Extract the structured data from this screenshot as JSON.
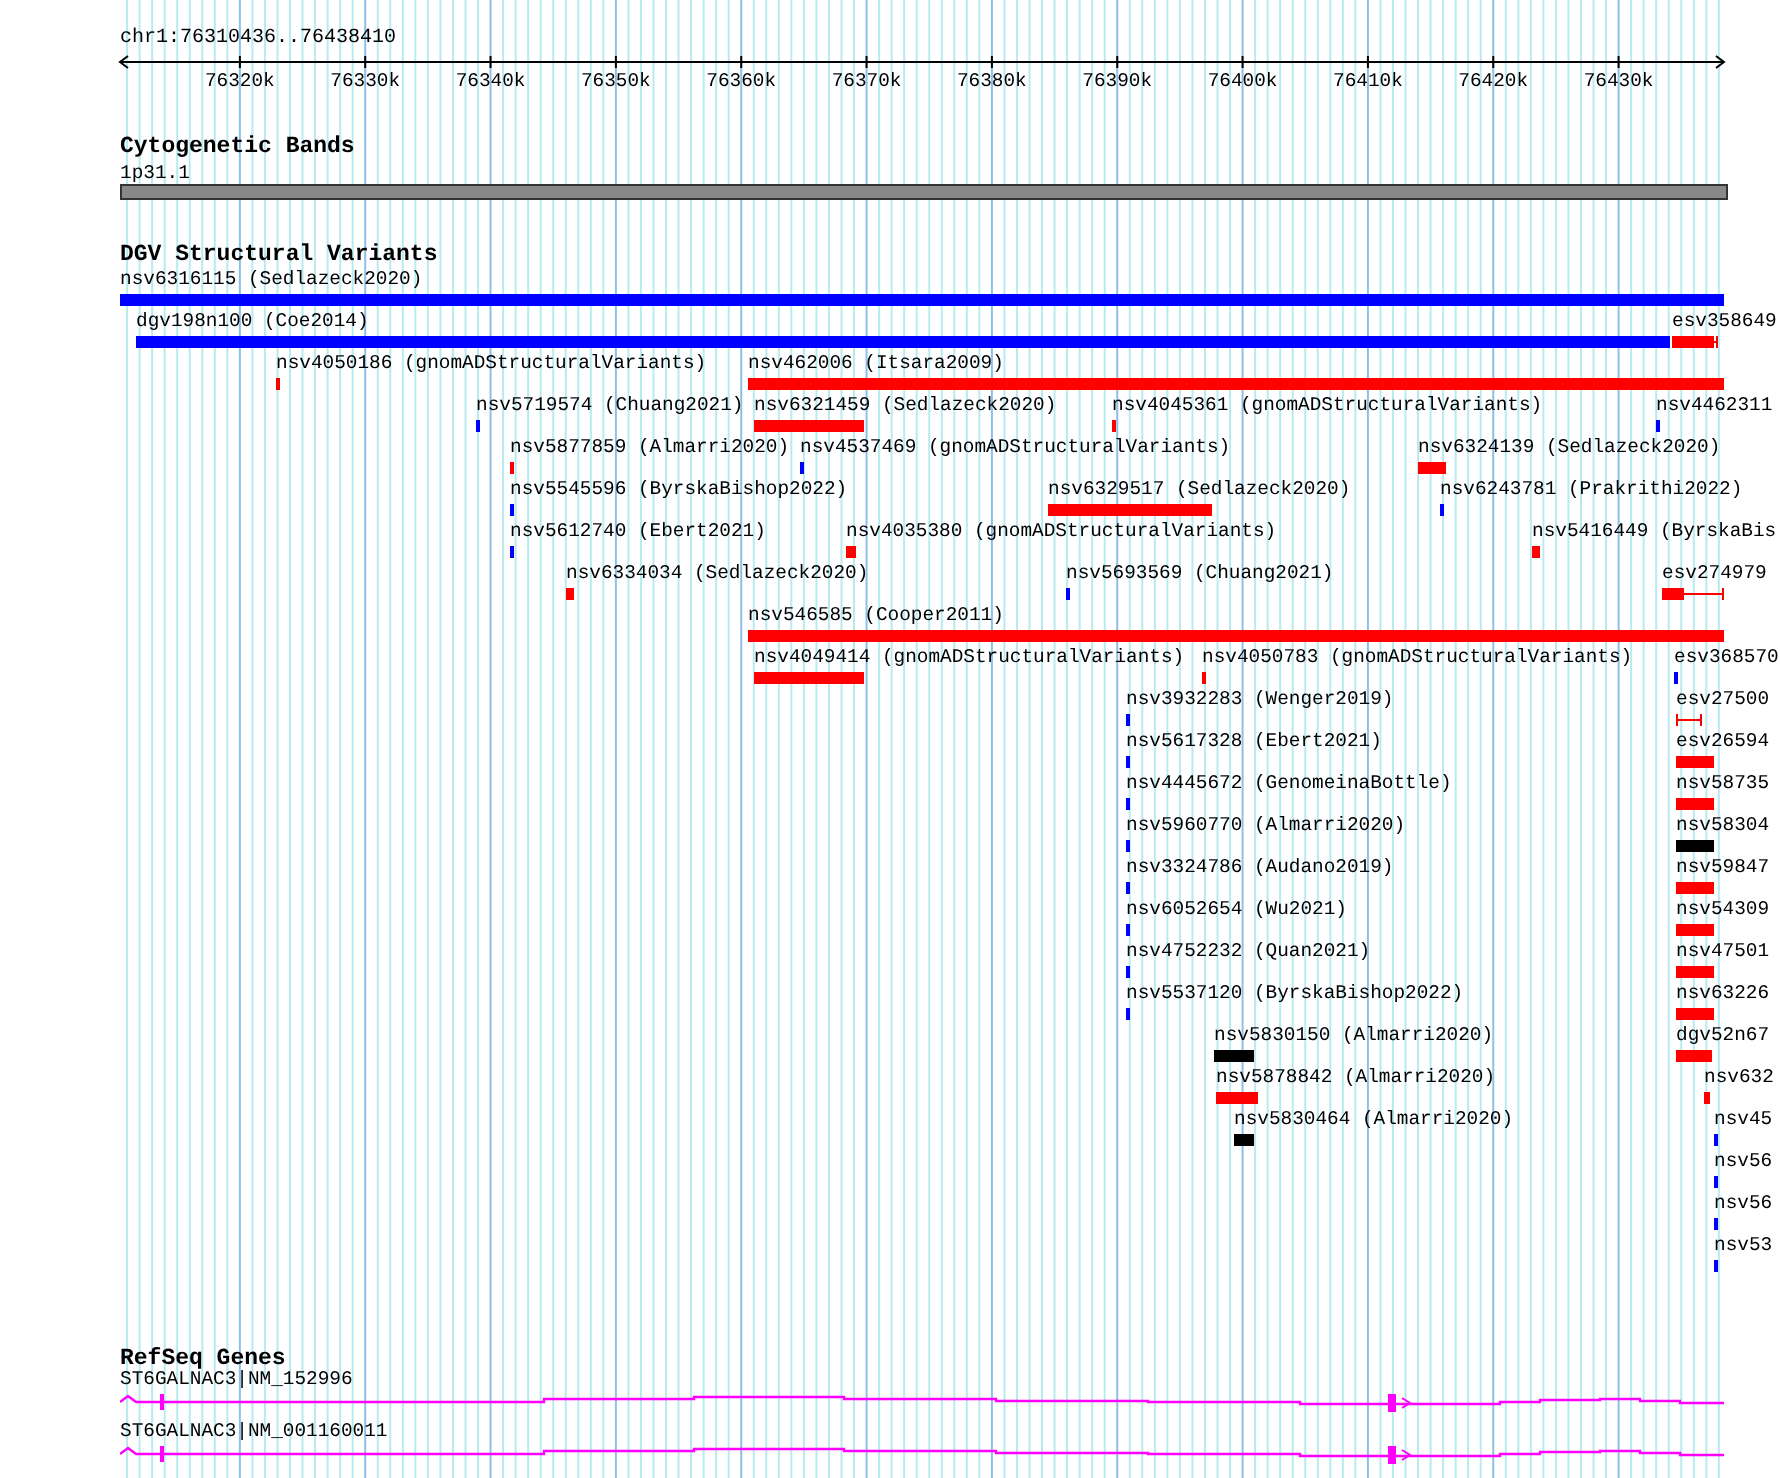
{
  "location": "chr1:76310436..76438410",
  "ruler": {
    "ticks": [
      "76320k",
      "76330k",
      "76340k",
      "76350k",
      "76360k",
      "76370k",
      "76380k",
      "76390k",
      "76400k",
      "76410k",
      "76420k",
      "76430k"
    ]
  },
  "tracks": [
    {
      "kind": "cytoband",
      "title": "Cytogenetic Bands",
      "features": [
        {
          "label": "1p31.1"
        }
      ]
    },
    {
      "kind": "variants",
      "title": "DGV Structural Variants",
      "features": [
        {
          "label": "nsv6316115 (Sedlazeck2020)",
          "color": "#0000ff",
          "kind": "bar"
        },
        {
          "label": "dgv198n100 (Coe2014)",
          "color": "#0000ff",
          "kind": "bar"
        },
        {
          "label": "esv358649",
          "color": "#ff0000",
          "kind": "whisker"
        },
        {
          "label": "nsv4050186 (gnomADStructuralVariants)",
          "color": "#ff0000",
          "kind": "bar"
        },
        {
          "label": "nsv462006 (Itsara2009)",
          "color": "#ff0000",
          "kind": "bar"
        },
        {
          "label": "nsv5719574 (Chuang2021)",
          "color": "#0000ff",
          "kind": "bar"
        },
        {
          "label": "nsv6321459 (Sedlazeck2020)",
          "color": "#ff0000",
          "kind": "bar"
        },
        {
          "label": "nsv4045361 (gnomADStructuralVariants)",
          "color": "#ff0000",
          "kind": "bar"
        },
        {
          "label": "nsv4462311",
          "color": "#0000ff",
          "kind": "bar"
        },
        {
          "label": "nsv5877859 (Almarri2020)",
          "color": "#ff0000",
          "kind": "bar"
        },
        {
          "label": "nsv4537469 (gnomADStructuralVariants)",
          "color": "#0000ff",
          "kind": "bar"
        },
        {
          "label": "nsv6324139 (Sedlazeck2020)",
          "color": "#ff0000",
          "kind": "bar"
        },
        {
          "label": "nsv5545596 (ByrskaBishop2022)",
          "color": "#0000ff",
          "kind": "bar"
        },
        {
          "label": "nsv6329517 (Sedlazeck2020)",
          "color": "#ff0000",
          "kind": "bar"
        },
        {
          "label": "nsv6243781 (Prakrithi2022)",
          "color": "#0000ff",
          "kind": "bar"
        },
        {
          "label": "nsv5612740 (Ebert2021)",
          "color": "#0000ff",
          "kind": "bar"
        },
        {
          "label": "nsv4035380 (gnomADStructuralVariants)",
          "color": "#ff0000",
          "kind": "bar"
        },
        {
          "label": "nsv5416449 (ByrskaBis",
          "color": "#ff0000",
          "kind": "bar"
        },
        {
          "label": "nsv6334034 (Sedlazeck2020)",
          "color": "#ff0000",
          "kind": "bar"
        },
        {
          "label": "nsv5693569 (Chuang2021)",
          "color": "#0000ff",
          "kind": "bar"
        },
        {
          "label": "esv274979",
          "color": "#ff0000",
          "kind": "whisker"
        },
        {
          "label": "nsv546585 (Cooper2011)",
          "color": "#ff0000",
          "kind": "bar"
        },
        {
          "label": "nsv4049414 (gnomADStructuralVariants)",
          "color": "#ff0000",
          "kind": "bar"
        },
        {
          "label": "nsv4050783 (gnomADStructuralVariants)",
          "color": "#ff0000",
          "kind": "bar"
        },
        {
          "label": "esv368570",
          "color": "#0000ff",
          "kind": "bar"
        },
        {
          "label": "nsv3932283 (Wenger2019)",
          "color": "#0000ff",
          "kind": "bar"
        },
        {
          "label": "esv27500",
          "color": "#ff0000",
          "kind": "whisker"
        },
        {
          "label": "nsv5617328 (Ebert2021)",
          "color": "#0000ff",
          "kind": "bar"
        },
        {
          "label": "esv26594",
          "color": "#ff0000",
          "kind": "bar"
        },
        {
          "label": "nsv4445672 (GenomeinaBottle)",
          "color": "#0000ff",
          "kind": "bar"
        },
        {
          "label": "nsv58735",
          "color": "#ff0000",
          "kind": "bar"
        },
        {
          "label": "nsv5960770 (Almarri2020)",
          "color": "#0000ff",
          "kind": "bar"
        },
        {
          "label": "nsv58304",
          "color": "#000000",
          "kind": "bar"
        },
        {
          "label": "nsv3324786 (Audano2019)",
          "color": "#0000ff",
          "kind": "bar"
        },
        {
          "label": "nsv59847",
          "color": "#ff0000",
          "kind": "bar"
        },
        {
          "label": "nsv6052654 (Wu2021)",
          "color": "#0000ff",
          "kind": "bar"
        },
        {
          "label": "nsv54309",
          "color": "#ff0000",
          "kind": "bar"
        },
        {
          "label": "nsv4752232 (Quan2021)",
          "color": "#0000ff",
          "kind": "bar"
        },
        {
          "label": "nsv47501",
          "color": "#ff0000",
          "kind": "bar"
        },
        {
          "label": "nsv5537120 (ByrskaBishop2022)",
          "color": "#0000ff",
          "kind": "bar"
        },
        {
          "label": "nsv63226",
          "color": "#ff0000",
          "kind": "bar"
        },
        {
          "label": "nsv5830150 (Almarri2020)",
          "color": "#000000",
          "kind": "bar"
        },
        {
          "label": "dgv52n67",
          "color": "#ff0000",
          "kind": "bar"
        },
        {
          "label": "nsv5878842 (Almarri2020)",
          "color": "#ff0000",
          "kind": "bar"
        },
        {
          "label": "nsv632",
          "color": "#ff0000",
          "kind": "bar"
        },
        {
          "label": "nsv5830464 (Almarri2020)",
          "color": "#000000",
          "kind": "bar"
        },
        {
          "label": "nsv45",
          "color": "#0000ff",
          "kind": "bar"
        },
        {
          "label": "nsv56",
          "color": "#0000ff",
          "kind": "bar"
        },
        {
          "label": "nsv56",
          "color": "#0000ff",
          "kind": "bar"
        },
        {
          "label": "nsv53",
          "color": "#0000ff",
          "kind": "bar"
        }
      ]
    },
    {
      "kind": "genes",
      "title": "RefSeq Genes",
      "features": [
        {
          "label": "ST6GALNAC3|NM_152996"
        },
        {
          "label": "ST6GALNAC3|NM_001160011"
        }
      ]
    }
  ]
}
